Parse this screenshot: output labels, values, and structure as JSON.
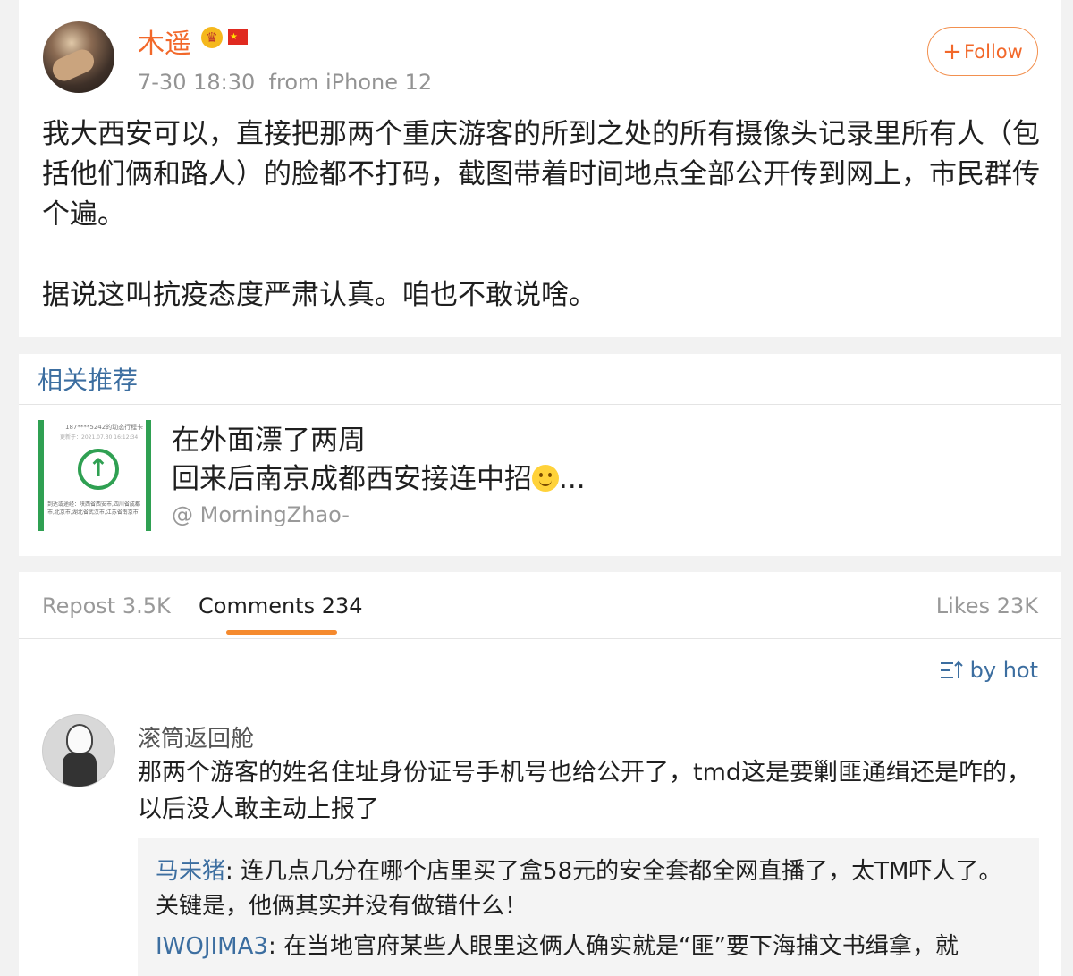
{
  "post": {
    "author": "木遥",
    "timestamp": "7-30 18:30",
    "source": "from iPhone 12",
    "follow_label": "Follow",
    "paragraph1": "我大西安可以，直接把那两个重庆游客的所到之处的所有摄像头记录里所有人（包括他们俩和路人）的脸都不打码，截图带着时间地点全部公开传到网上，市民群传个遍。",
    "paragraph2": "据说这叫抗疫态度严肃认真。咱也不敢说啥。"
  },
  "related": {
    "section_title": "相关推荐",
    "headline_line1": "在外面漂了两周",
    "headline_line2": "回来后南京成都西安接连中招",
    "headline_ellipsis": "...",
    "author": "@ MorningZhao-",
    "thumb_line1": "187****5242的动态行程卡",
    "thumb_line2": "更新于：2021.07.30 16:12:34",
    "thumb_line3": "到达或途经：陕西省西安市,四川省成都市,北京市,湖北省武汉市,江苏省南京市"
  },
  "tabs": {
    "repost_label": "Repost",
    "repost_count": "3.5K",
    "comments_label": "Comments",
    "comments_count": "234",
    "likes_label": "Likes",
    "likes_count": "23K"
  },
  "sort": {
    "label": "by hot"
  },
  "comment": {
    "author": "滚筒返回舱",
    "text": "那两个游客的姓名住址身份证号手机号也给公开了，tmd这是要剿匪通缉还是咋的，以后没人敢主动上报了",
    "replies": [
      {
        "author": "马未猪",
        "separator": ": ",
        "text": "连几点几分在哪个店里买了盒58元的安全套都全网直播了，太TM吓人了。关键是，他俩其实并没有做错什么！"
      },
      {
        "author": "IWOJIMA3",
        "separator": ": ",
        "text": "在当地官府某些人眼里这俩人确实就是“匪”要下海捕文书缉拿，就"
      }
    ]
  },
  "colors": {
    "accent_orange": "#f2682a",
    "link_blue": "#3c6ea0",
    "tab_underline": "#f58a2e",
    "health_code_green": "#2fa052"
  },
  "icons": [
    "crown-badge-icon",
    "china-flag-icon",
    "plus-icon",
    "up-arrow-icon",
    "smiley-emoji-icon",
    "sort-icon"
  ]
}
